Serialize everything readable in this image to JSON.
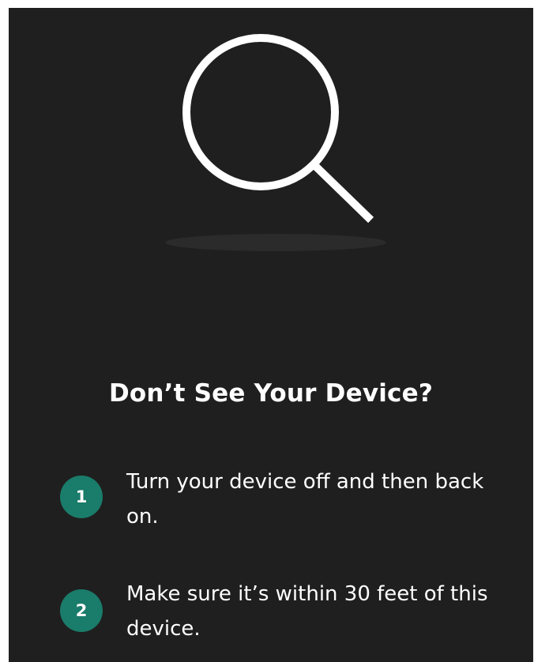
{
  "colors": {
    "background": "#1f1f1f",
    "accent": "#1a7c6a",
    "text": "#ffffff",
    "icon_stroke": "#ffffff"
  },
  "illustration": {
    "icon": "magnifying-glass-icon"
  },
  "title": "Don’t See Your Device?",
  "steps": [
    {
      "number": "1",
      "text": "Turn your device off and then back on."
    },
    {
      "number": "2",
      "text": "Make sure it’s within 30 feet of this device."
    }
  ]
}
